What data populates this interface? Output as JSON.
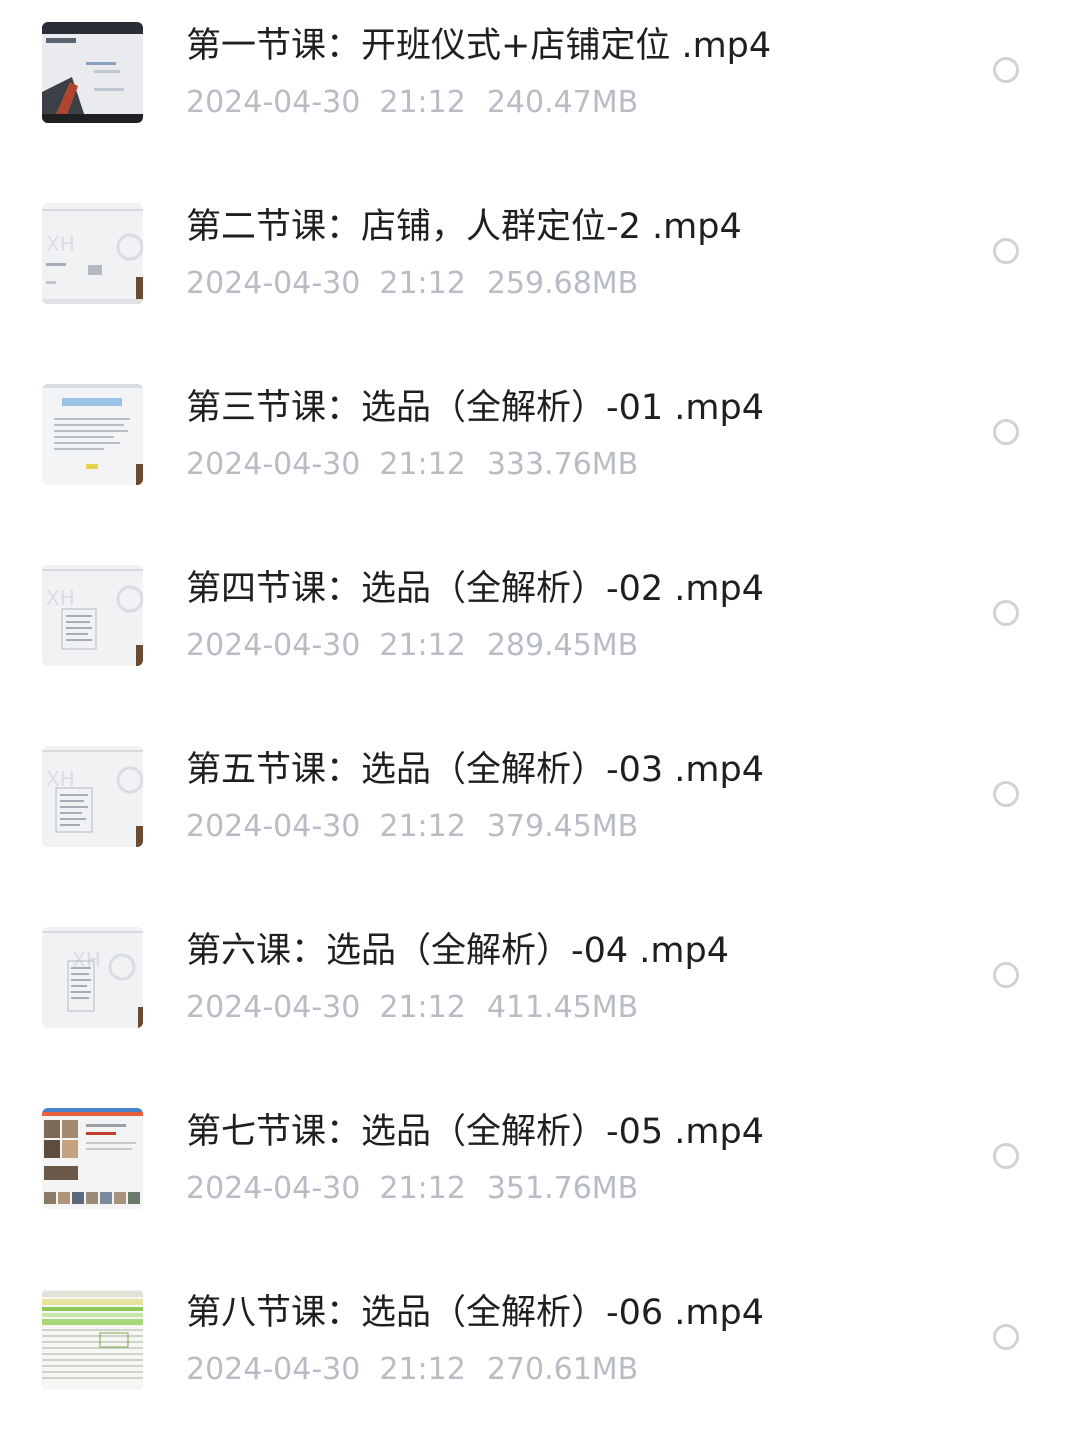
{
  "files": [
    {
      "title": "第一节课：开班仪式+店铺定位 .mp4",
      "date": "2024-04-30",
      "time": "21:12",
      "size": "240.47MB",
      "thumb_icon": "video-thumbnail-slide-dark"
    },
    {
      "title": "第二节课：店铺，人群定位-2 .mp4",
      "date": "2024-04-30",
      "time": "21:12",
      "size": "259.68MB",
      "thumb_icon": "video-thumbnail-slide-light"
    },
    {
      "title": "第三节课：选品（全解析）-01 .mp4",
      "date": "2024-04-30",
      "time": "21:12",
      "size": "333.76MB",
      "thumb_icon": "video-thumbnail-document"
    },
    {
      "title": "第四节课：选品（全解析）-02 .mp4",
      "date": "2024-04-30",
      "time": "21:12",
      "size": "289.45MB",
      "thumb_icon": "video-thumbnail-slide-light"
    },
    {
      "title": "第五节课：选品（全解析）-03 .mp4",
      "date": "2024-04-30",
      "time": "21:12",
      "size": "379.45MB",
      "thumb_icon": "video-thumbnail-slide-light"
    },
    {
      "title": "第六课：选品（全解析）-04 .mp4",
      "date": "2024-04-30",
      "time": "21:12",
      "size": "411.45MB",
      "thumb_icon": "video-thumbnail-slide-light"
    },
    {
      "title": "第七节课：选品（全解析）-05 .mp4",
      "date": "2024-04-30",
      "time": "21:12",
      "size": "351.76MB",
      "thumb_icon": "video-thumbnail-webpage"
    },
    {
      "title": "第八节课：选品（全解析）-06 .mp4",
      "date": "2024-04-30",
      "time": "21:12",
      "size": "270.61MB",
      "thumb_icon": "video-thumbnail-spreadsheet"
    }
  ],
  "colors": {
    "title_text": "#1f1f1f",
    "meta_text": "#b8bcc4",
    "radio_border": "#cfd2d7"
  }
}
